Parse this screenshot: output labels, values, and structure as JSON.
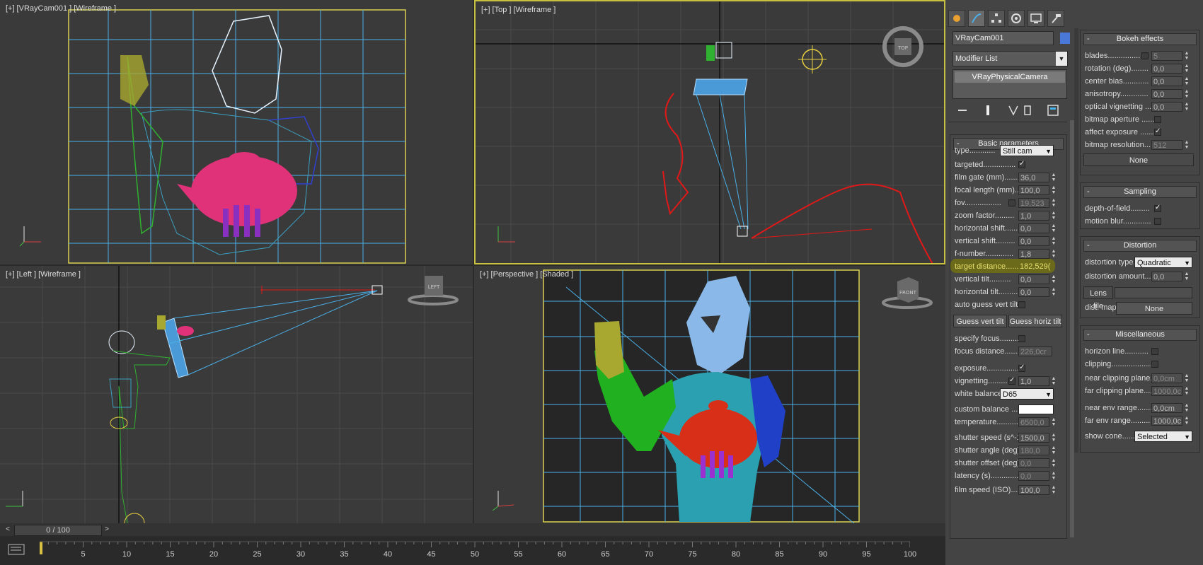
{
  "viewports": {
    "camera": {
      "tokens": [
        "[+]",
        "[VRayCam001 ]",
        "[Wireframe ]"
      ]
    },
    "top": {
      "tokens": [
        "[+]",
        "[Top ]",
        "[Wireframe ]"
      ],
      "cube": "TOP"
    },
    "left": {
      "tokens": [
        "[+]",
        "[Left ]",
        "[Wireframe ]"
      ],
      "cube": "LEFT"
    },
    "perspective": {
      "tokens": [
        "[+]",
        "[Perspective ]",
        "[Shaded ]"
      ],
      "cube": "FRONT"
    }
  },
  "timeline": {
    "slider": "0 / 100",
    "prev": "<",
    "next": ">",
    "ticks": [
      "5",
      "10",
      "15",
      "20",
      "25",
      "30",
      "35",
      "40",
      "45",
      "50",
      "55",
      "60",
      "65",
      "70",
      "75",
      "80",
      "85",
      "90",
      "95",
      "100"
    ]
  },
  "panel": {
    "object_name": "VRayCam001",
    "object_color": "#4a78d8",
    "modifier_list": "Modifier List",
    "modifier_item": "VRayPhysicalCamera",
    "basic": {
      "title": "Basic parameters",
      "type_label": "type............",
      "type_value": "Still cam",
      "targeted": "targeted...............",
      "film_gate": "film gate (mm).......",
      "film_gate_v": "36,0",
      "focal": "focal length (mm)....",
      "focal_v": "100,0",
      "fov": "fov.................",
      "fov_v": "19,523",
      "zoom": "zoom factor.........",
      "zoom_v": "1,0",
      "hshift": "horizontal shift......",
      "hshift_v": "0,0",
      "vshift": "vertical shift.........",
      "vshift_v": "0,0",
      "fnum": "f-number.............",
      "fnum_v": "1,8",
      "target": "target distance......",
      "target_v": "182,529(",
      "vtilt": "vertical tilt..........",
      "vtilt_v": "0,0",
      "htilt": "horizontal tilt.........",
      "htilt_v": "0,0",
      "autoguess": "auto guess vert tilt.",
      "guess_v": "Guess vert tilt",
      "guess_h": "Guess horiz tilt",
      "specify": "specify focus...........",
      "focus_dist": "focus distance.......",
      "focus_dist_v": "226,0cr",
      "exposure": "exposure...............",
      "vignetting": "vignetting.........",
      "vignetting_v": "1,0",
      "wb": "white balance",
      "wb_v": "D65",
      "custom": "custom balance ......",
      "temp": "temperature...........",
      "temp_v": "6500,0",
      "shutter": "shutter speed (s^-1",
      "shutter_v": "1500,0",
      "sangle": "shutter angle (deg).",
      "sangle_v": "180,0",
      "soffset": "shutter offset (deg).",
      "soffset_v": "0,0",
      "latency": "latency (s).............",
      "latency_v": "0,0",
      "iso": "film speed (ISO).....",
      "iso_v": "100,0"
    },
    "bokeh": {
      "title": "Bokeh effects",
      "blades": "blades...............",
      "blades_v": "5",
      "rotation": "rotation (deg)........",
      "rotation_v": "0,0",
      "center": "center bias............",
      "center_v": "0,0",
      "aniso": "anisotropy.............",
      "aniso_v": "0,0",
      "optical": "optical vignetting .....",
      "optical_v": "0,0",
      "bitmap_ap": "bitmap aperture ......",
      "affect": "affect exposure .......",
      "bitmap_res": "bitmap resolution.....",
      "bitmap_res_v": "512",
      "none_btn": "None"
    },
    "sampling": {
      "title": "Sampling",
      "dof": "depth-of-field.........",
      "motion": "motion blur............."
    },
    "distortion": {
      "title": "Distortion",
      "type": "distortion type.",
      "type_v": "Quadratic",
      "amount": "distortion amount....",
      "amount_v": "0,0",
      "lens": "Lens file",
      "map": "dist. map",
      "map_btn": "None"
    },
    "misc": {
      "title": "Miscellaneous",
      "horizon": "horizon line...........",
      "clipping": "clipping...................",
      "near_clip": "near clipping plane...",
      "near_clip_v": "0,0cm",
      "far_clip": "far clipping plane.....",
      "far_clip_v": "1000,0c",
      "near_env": "near env range.........",
      "near_env_v": "0,0cm",
      "far_env": "far env range.........",
      "far_env_v": "1000,0c",
      "cone": "show cone...........",
      "cone_v": "Selected"
    }
  }
}
